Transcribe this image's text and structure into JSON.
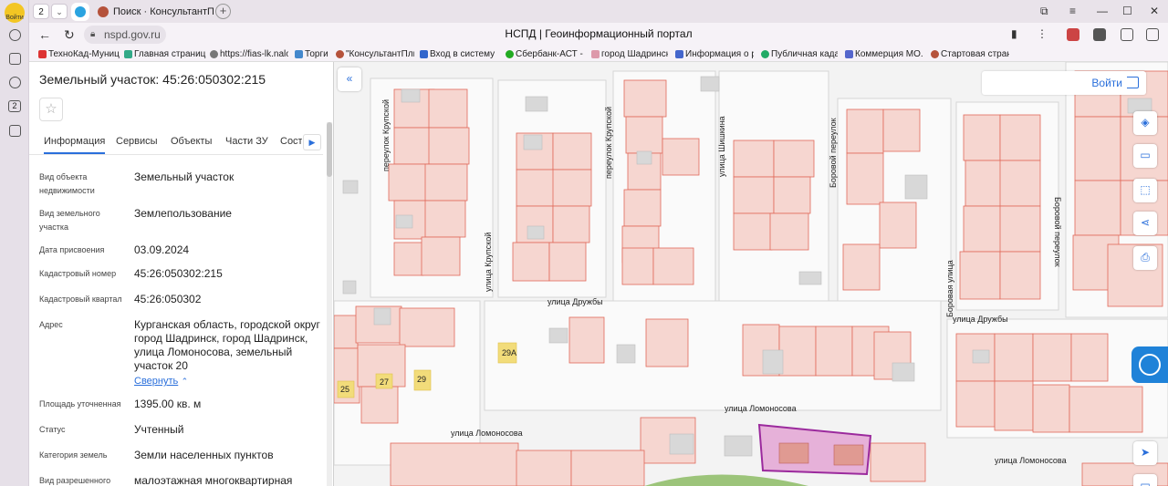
{
  "browser": {
    "profile_label": "Войти",
    "tab_count": "2",
    "tabs": [
      {
        "label": ""
      },
      {
        "label": "Поиск · КонсультантПлю"
      }
    ],
    "url": "nspd.gov.ru",
    "page_title": "НСПД | Геоинформационный портал",
    "bookmarks": [
      "ТехноКад-Муниц",
      "Главная страниц",
      "https://fias-lk.nalo",
      "Торги",
      "\"КонсультантПлю",
      "Вход в систему",
      "Сбербанк-АСТ -",
      "город Шадринск",
      "Информация о р",
      "Публичная кадас",
      "Коммерция МО.",
      "Стартовая стран"
    ]
  },
  "panel": {
    "title": "Земельный участок: 45:26:050302:215",
    "tabs": [
      "Информация",
      "Сервисы",
      "Объекты",
      "Части ЗУ",
      "Соста"
    ],
    "properties": [
      {
        "label": "Вид объекта недвижимости",
        "value": "Земельный участок"
      },
      {
        "label": "Вид земельного участка",
        "value": "Землепользование"
      },
      {
        "label": "Дата присвоения",
        "value": "03.09.2024"
      },
      {
        "label": "Кадастровый номер",
        "value": "45:26:050302:215"
      },
      {
        "label": "Кадастровый квартал",
        "value": "45:26:050302"
      },
      {
        "label": "Адрес",
        "value": "Курганская область, городской округ город Шадринск, город Шадринск, улица Ломоносова, земельный участок 20"
      },
      {
        "label": "Площадь уточненная",
        "value": "1395.00 кв. м"
      },
      {
        "label": "Статус",
        "value": "Учтенный"
      },
      {
        "label": "Категория земель",
        "value": "Земли населенных пунктов"
      },
      {
        "label": "Вид разрешенного",
        "value": "малоэтажная многоквартирная"
      }
    ],
    "collapse_label": "Свернуть"
  },
  "map": {
    "login_label": "Войти",
    "streets": {
      "krupskoy_lane_1": "переулок Крупской",
      "krupskoy_lane_2": "переулок Крупской",
      "krupskoy_st": "улица Крупской",
      "shishkina": "улица Шишкина",
      "borovoy_lane_1": "Боровой переулок",
      "borovoy_lane_2": "Боровой переулок",
      "borovaya": "Боровая улица",
      "druzhby_1": "улица Дружбы",
      "druzhby_2": "улица Дружбы",
      "lomonosova_1": "улица Ломоносова",
      "lomonosova_2": "улица Ломоносова",
      "lomonosova_3": "улица Ломоносова"
    },
    "house_numbers": [
      "29А",
      "27",
      "29",
      "25"
    ]
  }
}
